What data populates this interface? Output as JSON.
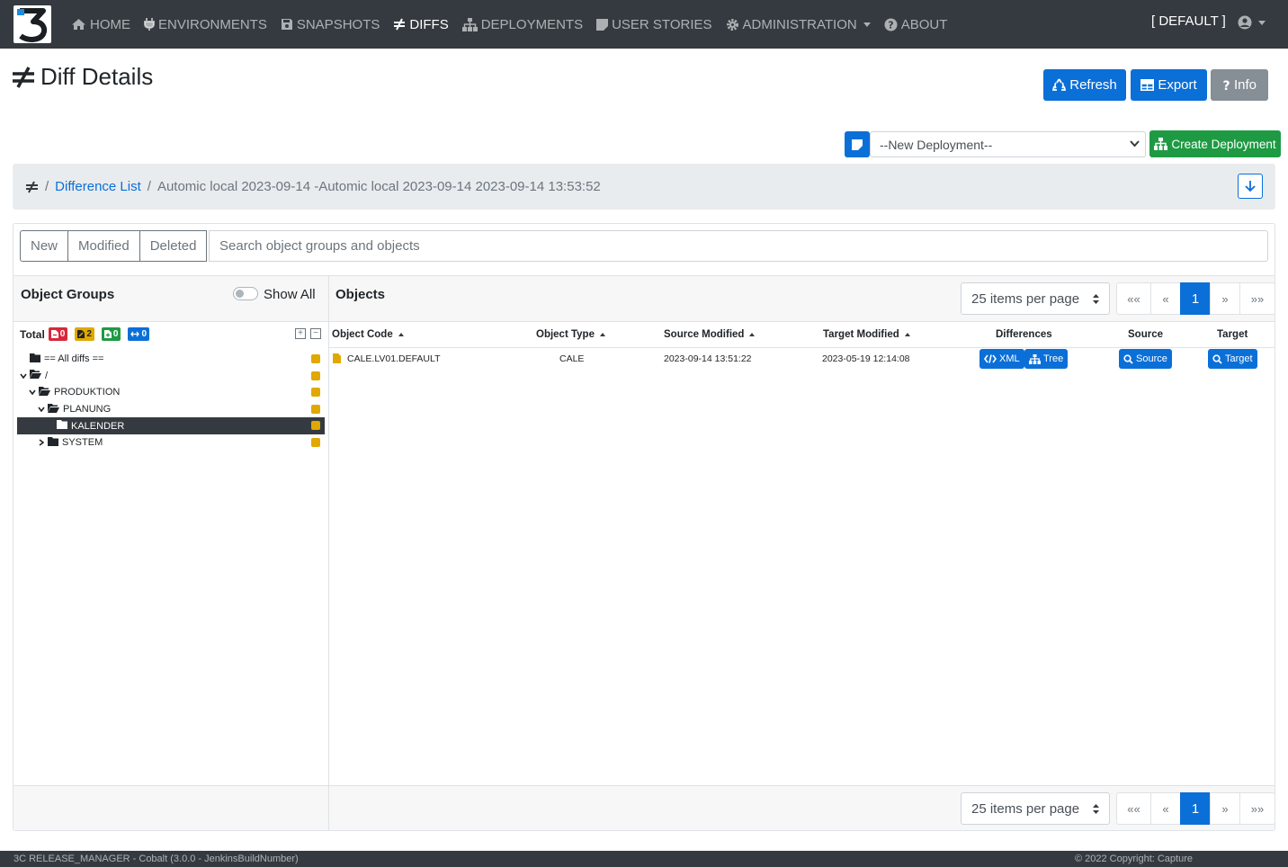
{
  "nav": {
    "items": [
      {
        "label": "HOME",
        "icon": "home-icon"
      },
      {
        "label": "ENVIRONMENTS",
        "icon": "plug-icon"
      },
      {
        "label": "SNAPSHOTS",
        "icon": "save-icon"
      },
      {
        "label": "DIFFS",
        "icon": "not-equal-icon",
        "active": true
      },
      {
        "label": "DEPLOYMENTS",
        "icon": "sitemap-icon"
      },
      {
        "label": "USER STORIES",
        "icon": "sticky-note-icon"
      },
      {
        "label": "ADMINISTRATION",
        "icon": "gear-icon",
        "dropdown": true
      },
      {
        "label": "ABOUT",
        "icon": "question-circle-icon"
      }
    ],
    "environment": "[ DEFAULT ]"
  },
  "header": {
    "title": "Diff Details",
    "refresh_label": "Refresh",
    "export_label": "Export",
    "info_label": "Info"
  },
  "deployment": {
    "selected": "--New Deployment--",
    "create_label": "Create Deployment"
  },
  "breadcrumb": {
    "link": "Difference List",
    "current": "Automic local 2023-09-14 -Automic local 2023-09-14 2023-09-14 13:53:52"
  },
  "filters": {
    "new_label": "New",
    "modified_label": "Modified",
    "deleted_label": "Deleted",
    "search_placeholder": "Search object groups and objects"
  },
  "groups": {
    "title": "Object Groups",
    "show_all_label": "Show All",
    "total_label": "Total",
    "counts": {
      "deleted": "0",
      "modified": "2",
      "new": "0",
      "moved": "0"
    },
    "tree": [
      {
        "label": "== All diffs ==",
        "level": 0,
        "toggle": "",
        "open": false
      },
      {
        "label": "/",
        "level": 0,
        "toggle": "down",
        "open": true
      },
      {
        "label": "PRODUKTION",
        "level": 1,
        "toggle": "down",
        "open": true
      },
      {
        "label": "PLANUNG",
        "level": 2,
        "toggle": "down",
        "open": true
      },
      {
        "label": "KALENDER",
        "level": 3,
        "toggle": "",
        "open": false,
        "selected": true
      },
      {
        "label": "SYSTEM",
        "level": 2,
        "toggle": "right",
        "open": false
      }
    ]
  },
  "objects": {
    "title": "Objects",
    "items_per_page": "25 items per page",
    "pager": {
      "first": "««",
      "prev": "«",
      "current": "1",
      "next": "»",
      "last": "»»"
    },
    "columns": {
      "code": "Object Code",
      "type": "Object Type",
      "source_modified": "Source Modified",
      "target_modified": "Target Modified",
      "differences": "Differences",
      "source": "Source",
      "target": "Target"
    },
    "rows": [
      {
        "code": "CALE.LV01.DEFAULT",
        "type": "CALE",
        "source_modified": "2023-09-14 13:51:22",
        "target_modified": "2023-05-19 12:14:08",
        "xml_label": "XML",
        "tree_label": "Tree",
        "source_label": "Source",
        "target_label": "Target"
      }
    ]
  },
  "footer": {
    "left": "3C RELEASE_MANAGER - Cobalt (3.0.0 - JenkinsBuildNumber)",
    "right": "© 2022 Copyright: Capture"
  },
  "colors": {
    "navbar": "#343a40",
    "primary": "#0b6fd8",
    "success": "#1e9a43",
    "danger": "#d9283a",
    "warning": "#e0a800",
    "secondary": "#868e96"
  }
}
